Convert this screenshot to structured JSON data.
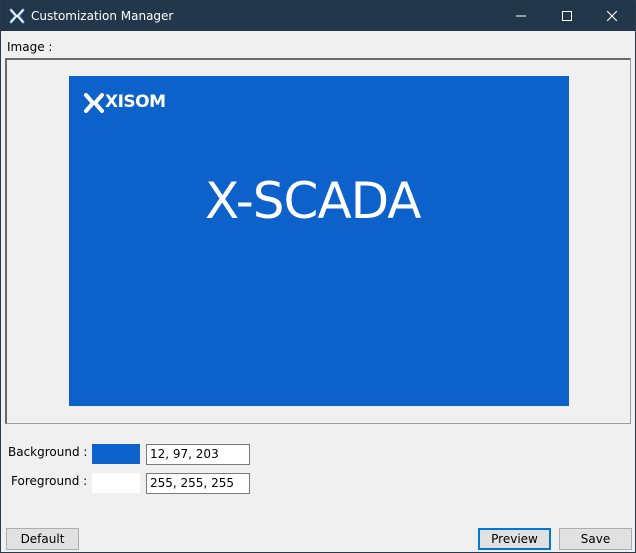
{
  "window": {
    "title": "Customization Manager",
    "icon": "x-logo-icon"
  },
  "title_buttons": {
    "minimize": "minimize-icon",
    "maximize": "maximize-icon",
    "close": "close-icon"
  },
  "image_section": {
    "label": "Image :",
    "preview": {
      "logo_text": "XISOM",
      "brand_text": "X-SCADA",
      "background_color": "#0c61cb",
      "foreground_color": "#ffffff"
    }
  },
  "colors": {
    "background": {
      "label": "Background :",
      "value": "12, 97, 203",
      "swatch": "#0c61cb"
    },
    "foreground": {
      "label": "Foreground :",
      "value": "255, 255, 255",
      "swatch": "#ffffff"
    }
  },
  "buttons": {
    "default": "Default",
    "preview": "Preview",
    "save": "Save"
  }
}
